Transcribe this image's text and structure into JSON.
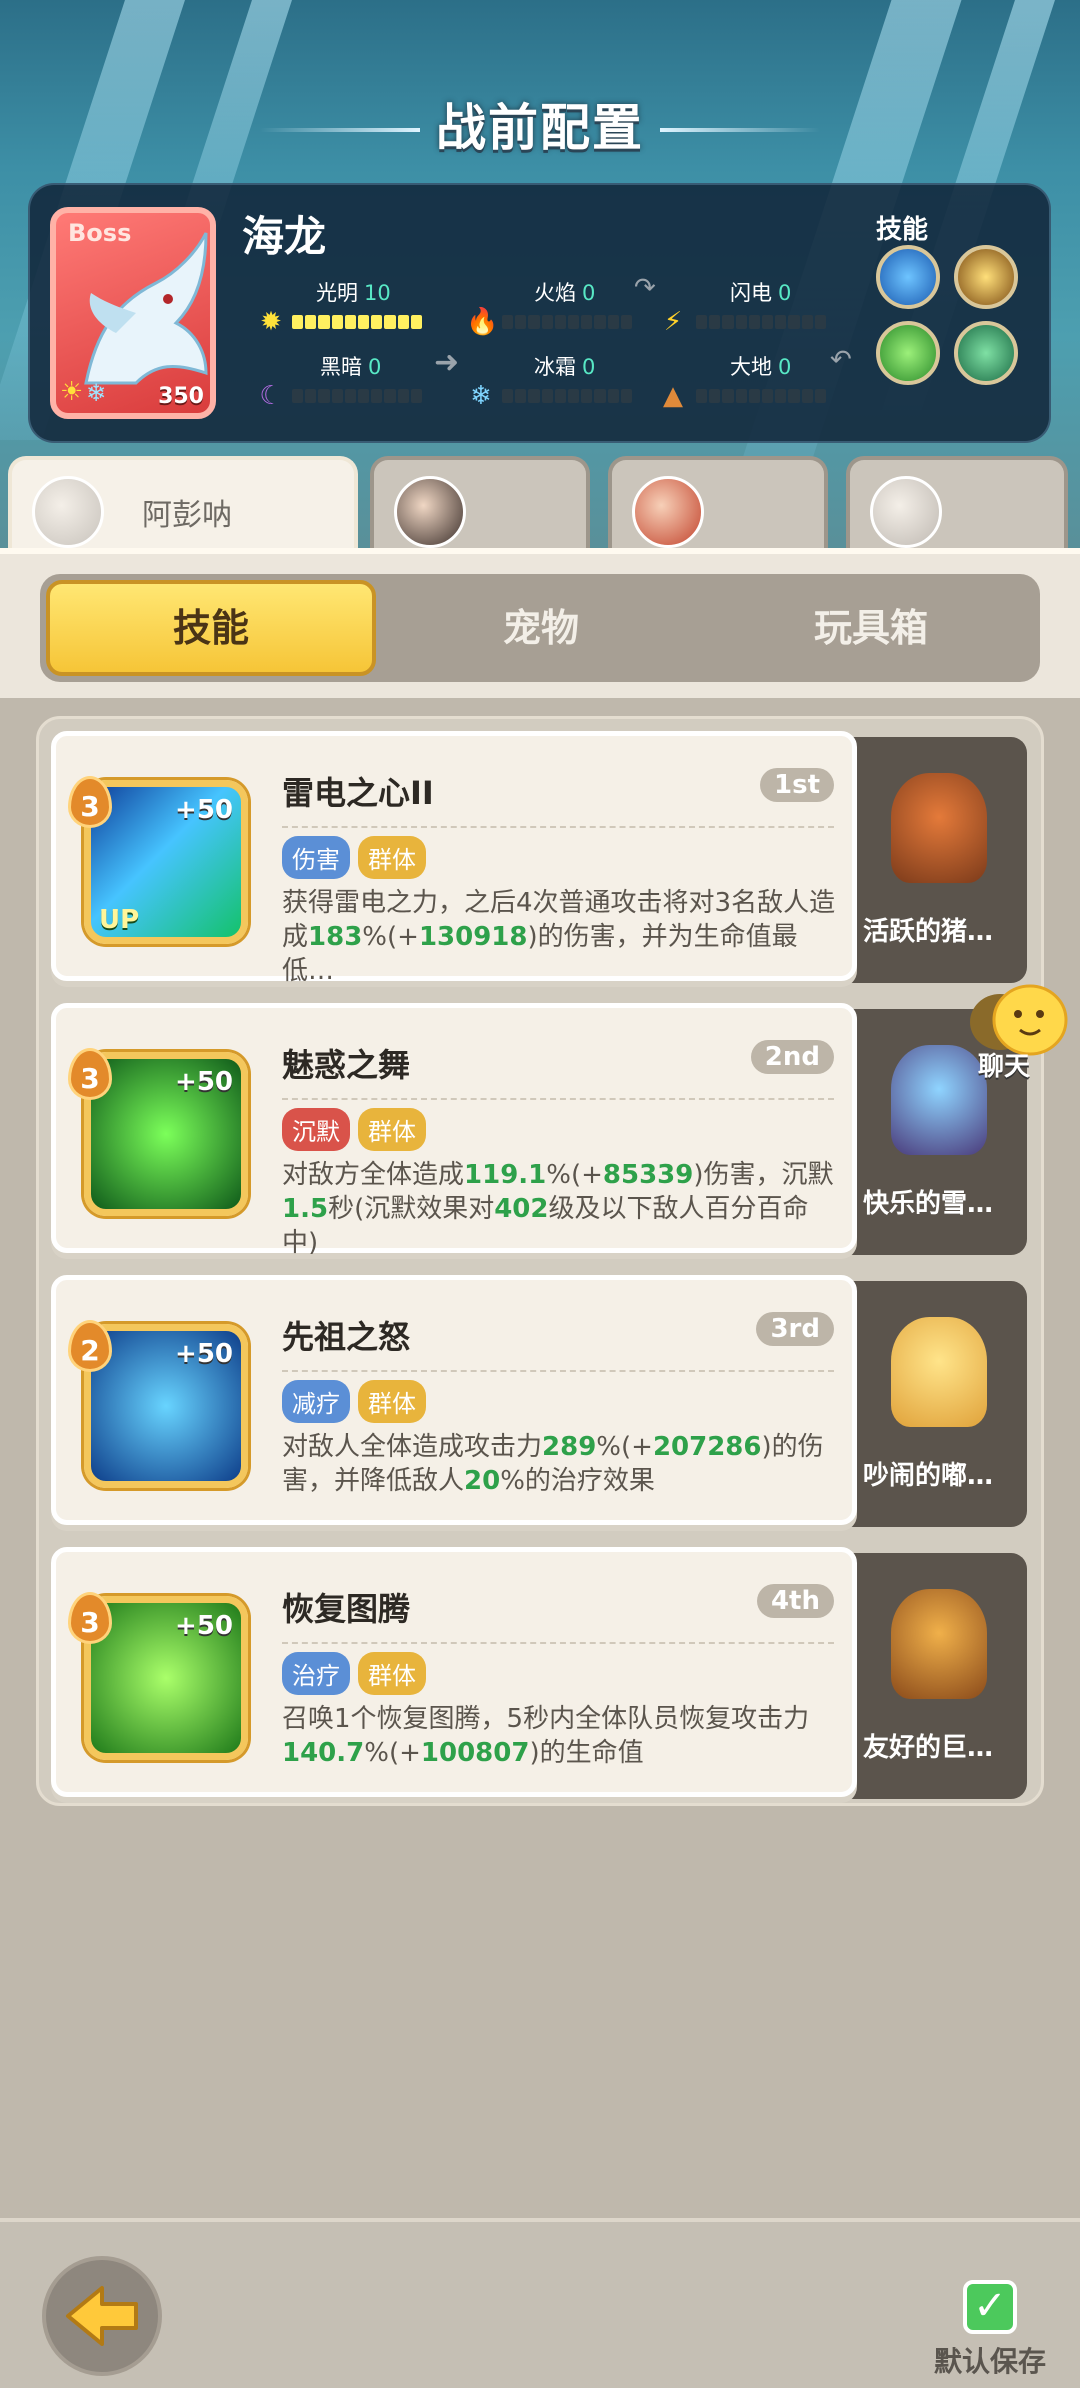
{
  "header": {
    "title": "战前配置"
  },
  "boss": {
    "tag": "Boss",
    "name": "海龙",
    "level": "350",
    "skills_label": "技能",
    "attributes": [
      {
        "name": "光明",
        "value": "10"
      },
      {
        "name": "火焰",
        "value": "0"
      },
      {
        "name": "闪电",
        "value": "0"
      },
      {
        "name": "黑暗",
        "value": "0"
      },
      {
        "name": "冰霜",
        "value": "0"
      },
      {
        "name": "大地",
        "value": "0"
      }
    ]
  },
  "heroes": [
    {
      "name": "阿彭呐",
      "active": true
    },
    {
      "name": "",
      "active": false
    },
    {
      "name": "",
      "active": false
    },
    {
      "name": "",
      "active": false
    }
  ],
  "tabs": [
    "技能",
    "宠物",
    "玩具箱"
  ],
  "skills": [
    {
      "level": "3",
      "plus": "+50",
      "up": "UP",
      "title": "雷电之心II",
      "rank": "1st",
      "tags": [
        {
          "label": "伤害",
          "color": "#5b8fd6"
        },
        {
          "label": "群体",
          "color": "#e8b43c"
        }
      ],
      "desc_parts": [
        "获得雷电之力，之后4次普通攻击将对3名敌人造成",
        "183",
        "%(+",
        "130918",
        ")的伤害，并为生命值最低…"
      ],
      "pet": "活跃的猪…"
    },
    {
      "level": "3",
      "plus": "+50",
      "up": "",
      "title": "魅惑之舞",
      "rank": "2nd",
      "tags": [
        {
          "label": "沉默",
          "color": "#d9534a"
        },
        {
          "label": "群体",
          "color": "#e8b43c"
        }
      ],
      "desc_parts": [
        "对敌方全体造成",
        "119.1",
        "%(+",
        "85339",
        ")伤害，沉默",
        "1.5",
        "秒(沉默效果对",
        "402",
        "级及以下敌人百分百命中)"
      ],
      "pet": "快乐的雪…"
    },
    {
      "level": "2",
      "plus": "+50",
      "up": "",
      "title": "先祖之怒",
      "rank": "3rd",
      "tags": [
        {
          "label": "减疗",
          "color": "#5b8fd6"
        },
        {
          "label": "群体",
          "color": "#e8b43c"
        }
      ],
      "desc_parts": [
        "对敌人全体造成攻击力",
        "289",
        "%(+",
        "207286",
        ")的伤害，并降低敌人",
        "20",
        "%的治疗效果"
      ],
      "pet": "吵闹的嘟…"
    },
    {
      "level": "3",
      "plus": "+50",
      "up": "",
      "title": "恢复图腾",
      "rank": "4th",
      "tags": [
        {
          "label": "治疗",
          "color": "#5b8fd6"
        },
        {
          "label": "群体",
          "color": "#e8b43c"
        }
      ],
      "desc_parts": [
        "召唤1个恢复图腾，5秒内全体队员恢复攻击力",
        "140.7",
        "%(+",
        "100807",
        ")的生命值"
      ],
      "pet": "友好的巨…"
    }
  ],
  "chat": {
    "label": "聊天"
  },
  "footer": {
    "save_label": "默认保存"
  },
  "colors": {
    "accent_yellow": "#f6c537",
    "highlight_green": "#2ea14a",
    "panel_dark": "#11263a"
  }
}
